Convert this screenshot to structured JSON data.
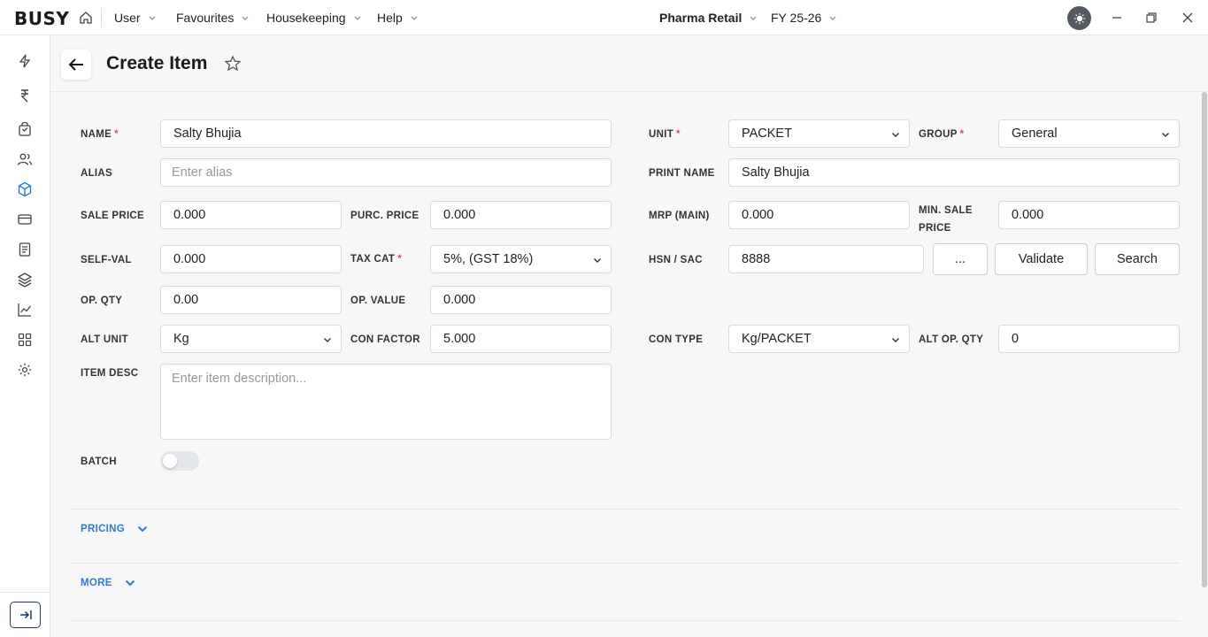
{
  "app": {
    "logo": "BUSY",
    "menus": [
      "User",
      "Favourites",
      "Housekeeping",
      "Help"
    ],
    "company": "Pharma Retail",
    "fy": "FY 25-26"
  },
  "sidebar": {
    "icons": [
      "lightning-icon",
      "rupee-icon",
      "bag-icon",
      "users-icon",
      "cube-icon",
      "card-icon",
      "document-icon",
      "layers-icon",
      "chart-icon",
      "grid-icon",
      "gear-icon"
    ]
  },
  "header": {
    "title": "Create Item"
  },
  "form": {
    "name": {
      "label": "NAME",
      "value": "Salty Bhujia"
    },
    "alias": {
      "label": "ALIAS",
      "placeholder": "Enter alias"
    },
    "sale_price": {
      "label": "SALE PRICE",
      "value": "0.000"
    },
    "purc_price": {
      "label": "PURC. PRICE",
      "value": "0.000"
    },
    "self_val": {
      "label": "SELF-VAL",
      "value": "0.000"
    },
    "tax_cat": {
      "label": "TAX CAT",
      "value": "5%, (GST 18%)"
    },
    "op_qty": {
      "label": "OP. QTY",
      "value": "0.00"
    },
    "op_value": {
      "label": "OP. VALUE",
      "value": "0.000"
    },
    "alt_unit": {
      "label": "ALT UNIT",
      "value": "Kg"
    },
    "con_factor": {
      "label": "CON FACTOR",
      "value": "5.000"
    },
    "item_desc": {
      "label": "ITEM DESC",
      "placeholder": "Enter item description..."
    },
    "batch": {
      "label": "BATCH",
      "enabled": false
    },
    "unit": {
      "label": "UNIT",
      "value": "PACKET"
    },
    "group": {
      "label": "GROUP",
      "value": "General"
    },
    "print_name": {
      "label": "PRINT NAME",
      "value": "Salty Bhujia"
    },
    "mrp": {
      "label": "MRP (MAIN)",
      "value": "0.000"
    },
    "min_sale_price": {
      "label_1": "MIN. SALE",
      "label_2": "PRICE",
      "value": "0.000"
    },
    "hsn": {
      "label": "HSN / SAC",
      "value": "8888",
      "more_label": "...",
      "validate_label": "Validate",
      "search_label": "Search"
    },
    "con_type": {
      "label": "CON TYPE",
      "value": "Kg/PACKET"
    },
    "alt_op_qty": {
      "label": "ALT OP. QTY",
      "value": "0"
    }
  },
  "sections": {
    "pricing": "PRICING",
    "more": "MORE"
  },
  "colors": {
    "accent": "#2d7ad1",
    "required": "#d9534f"
  }
}
